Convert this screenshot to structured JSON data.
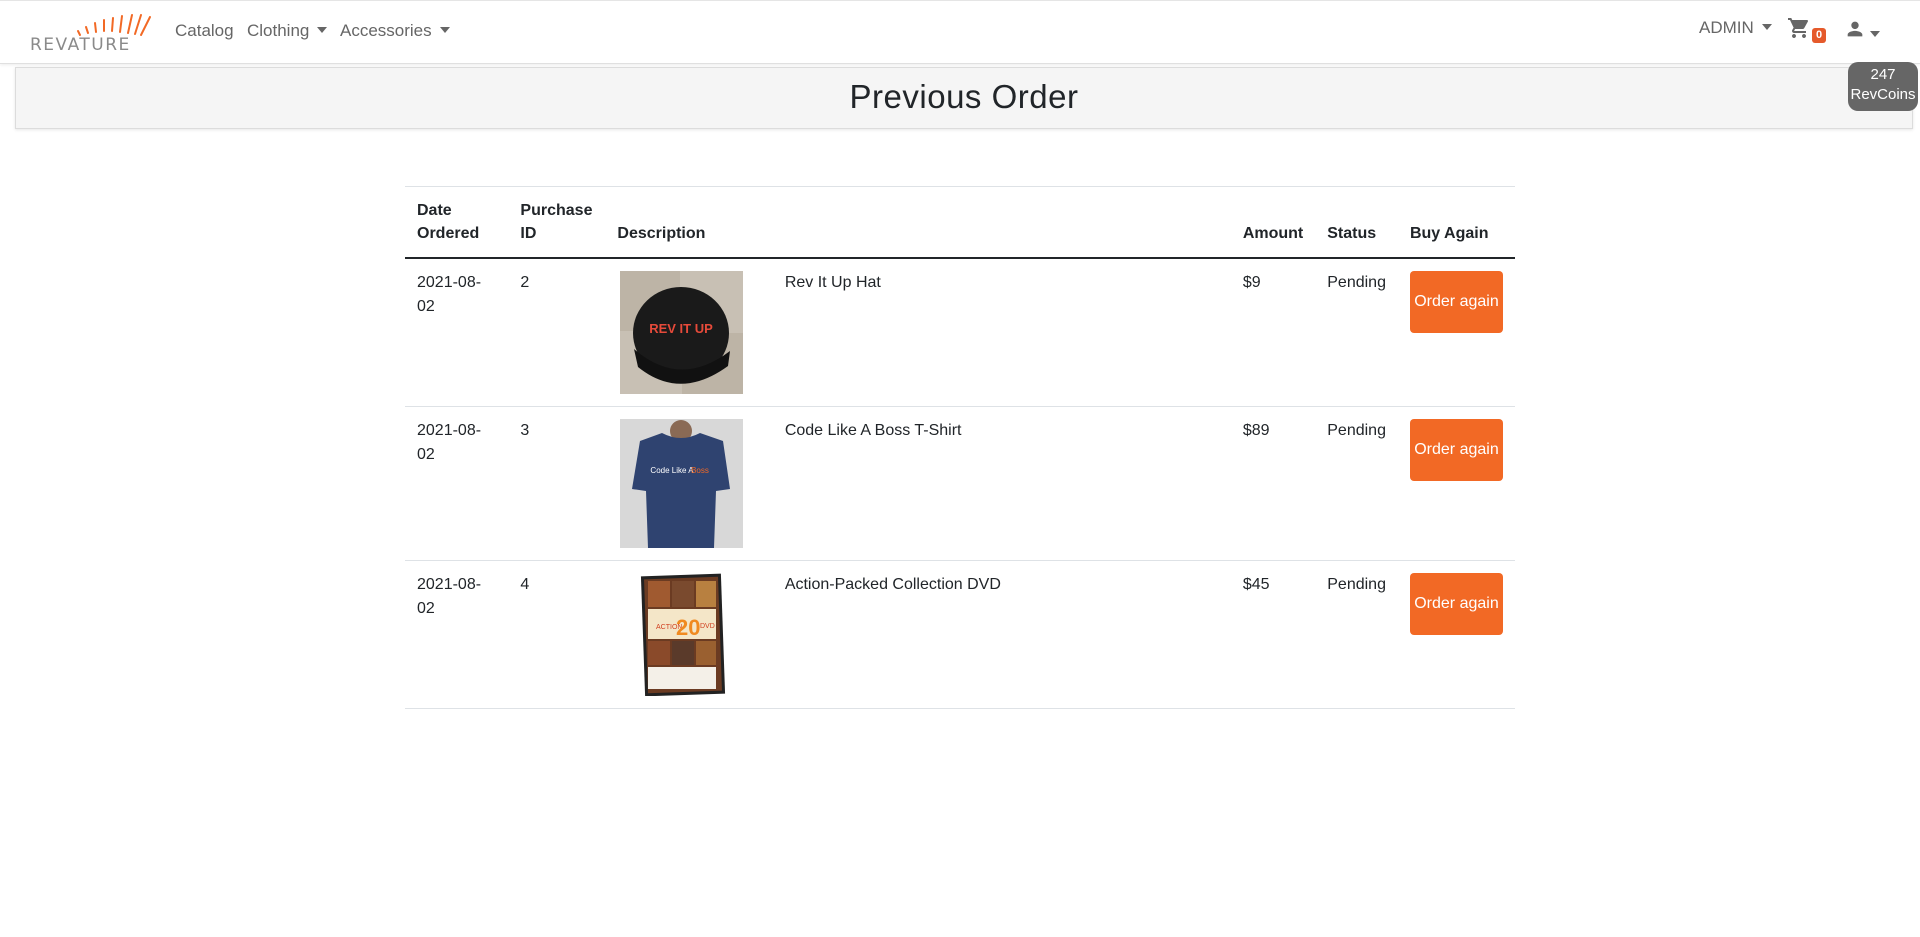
{
  "brand": {
    "name": "REVATURE",
    "accent": "#f26925"
  },
  "nav": {
    "catalog": "Catalog",
    "clothing": "Clothing",
    "accessories": "Accessories",
    "admin": "ADMIN",
    "cart_count": "0"
  },
  "revcoins": {
    "amount": "247",
    "label": "RevCoins"
  },
  "page": {
    "title": "Previous Order"
  },
  "table": {
    "headers": {
      "date": "Date Ordered",
      "purchase_id": "Purchase ID",
      "description": "Description",
      "amount": "Amount",
      "status": "Status",
      "buy_again": "Buy Again"
    },
    "rows": [
      {
        "date": "2021-08-02",
        "id": "2",
        "description": "Rev It Up Hat",
        "amount": "$9",
        "status": "Pending",
        "button": "Order again",
        "image": "hat-image"
      },
      {
        "date": "2021-08-02",
        "id": "3",
        "description": "Code Like A Boss T-Shirt",
        "amount": "$89",
        "status": "Pending",
        "button": "Order again",
        "image": "tshirt-image"
      },
      {
        "date": "2021-08-02",
        "id": "4",
        "description": "Action-Packed Collection DVD",
        "amount": "$45",
        "status": "Pending",
        "button": "Order again",
        "image": "dvd-image"
      }
    ]
  },
  "images": {
    "hat_text": "REV IT UP",
    "shirt_text_a": "Code Like A",
    "shirt_text_b": "Boss",
    "dvd_text_a": "ACTION",
    "dvd_text_b": "20",
    "dvd_text_c": "DVD"
  }
}
